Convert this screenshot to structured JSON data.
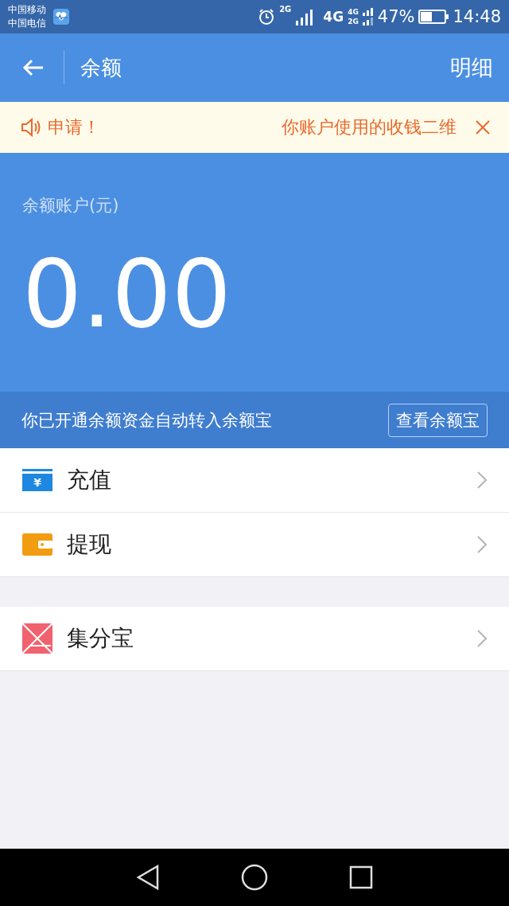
{
  "status_bar": {
    "carriers": [
      "中国移动",
      "中国电信"
    ],
    "sim1_network": "2G",
    "sim2_network": "4G",
    "dual_labels": [
      "4G",
      "2G"
    ],
    "battery": "47%",
    "time": "14:48"
  },
  "header": {
    "title": "余额",
    "action": "明细"
  },
  "notice": {
    "texts": [
      "申请！",
      "你账户使用的收钱二维"
    ]
  },
  "balance": {
    "label": "余额账户(元)",
    "amount": "0.00",
    "info": "你已开通余额资金自动转入余额宝",
    "button": "查看余额宝"
  },
  "menu_groups": [
    [
      {
        "kind": "recharge",
        "label": "充值",
        "icon_glyph": "¥"
      },
      {
        "kind": "withdraw",
        "label": "提现"
      }
    ],
    [
      {
        "kind": "points",
        "label": "集分宝"
      }
    ]
  ]
}
